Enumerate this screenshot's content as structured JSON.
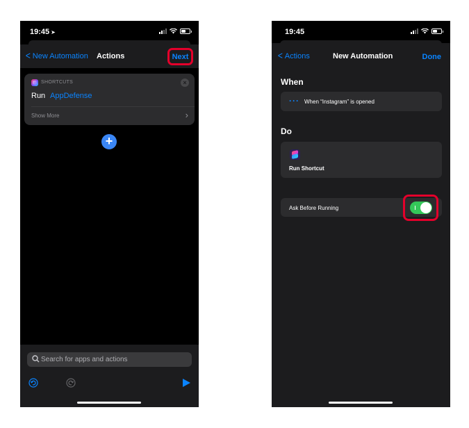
{
  "left_screen": {
    "status_time": "19:45",
    "nav": {
      "back_label": "New Automation",
      "title": "Actions",
      "next_label": "Next"
    },
    "action_card": {
      "app_label": "SHORTCUTS",
      "run_label": "Run",
      "run_target": "AppDefense",
      "show_more_label": "Show More"
    },
    "search": {
      "placeholder": "Search for apps and actions"
    },
    "icons": [
      "undo-icon",
      "redo-icon",
      "play-icon",
      "add-icon",
      "close-icon",
      "search-icon"
    ]
  },
  "right_screen": {
    "status_time": "19:45",
    "nav": {
      "back_label": "Actions",
      "title": "New Automation",
      "done_label": "Done"
    },
    "when": {
      "title": "When",
      "trigger_text": "When “Instagram” is opened"
    },
    "do": {
      "title": "Do",
      "action_label": "Run Shortcut"
    },
    "ask_before_running": {
      "label": "Ask Before Running",
      "enabled": true
    }
  },
  "colors": {
    "accent": "#0a84ff",
    "highlight": "#e4002b",
    "toggle_on": "#34c759",
    "cell_bg": "#2c2c2e"
  }
}
